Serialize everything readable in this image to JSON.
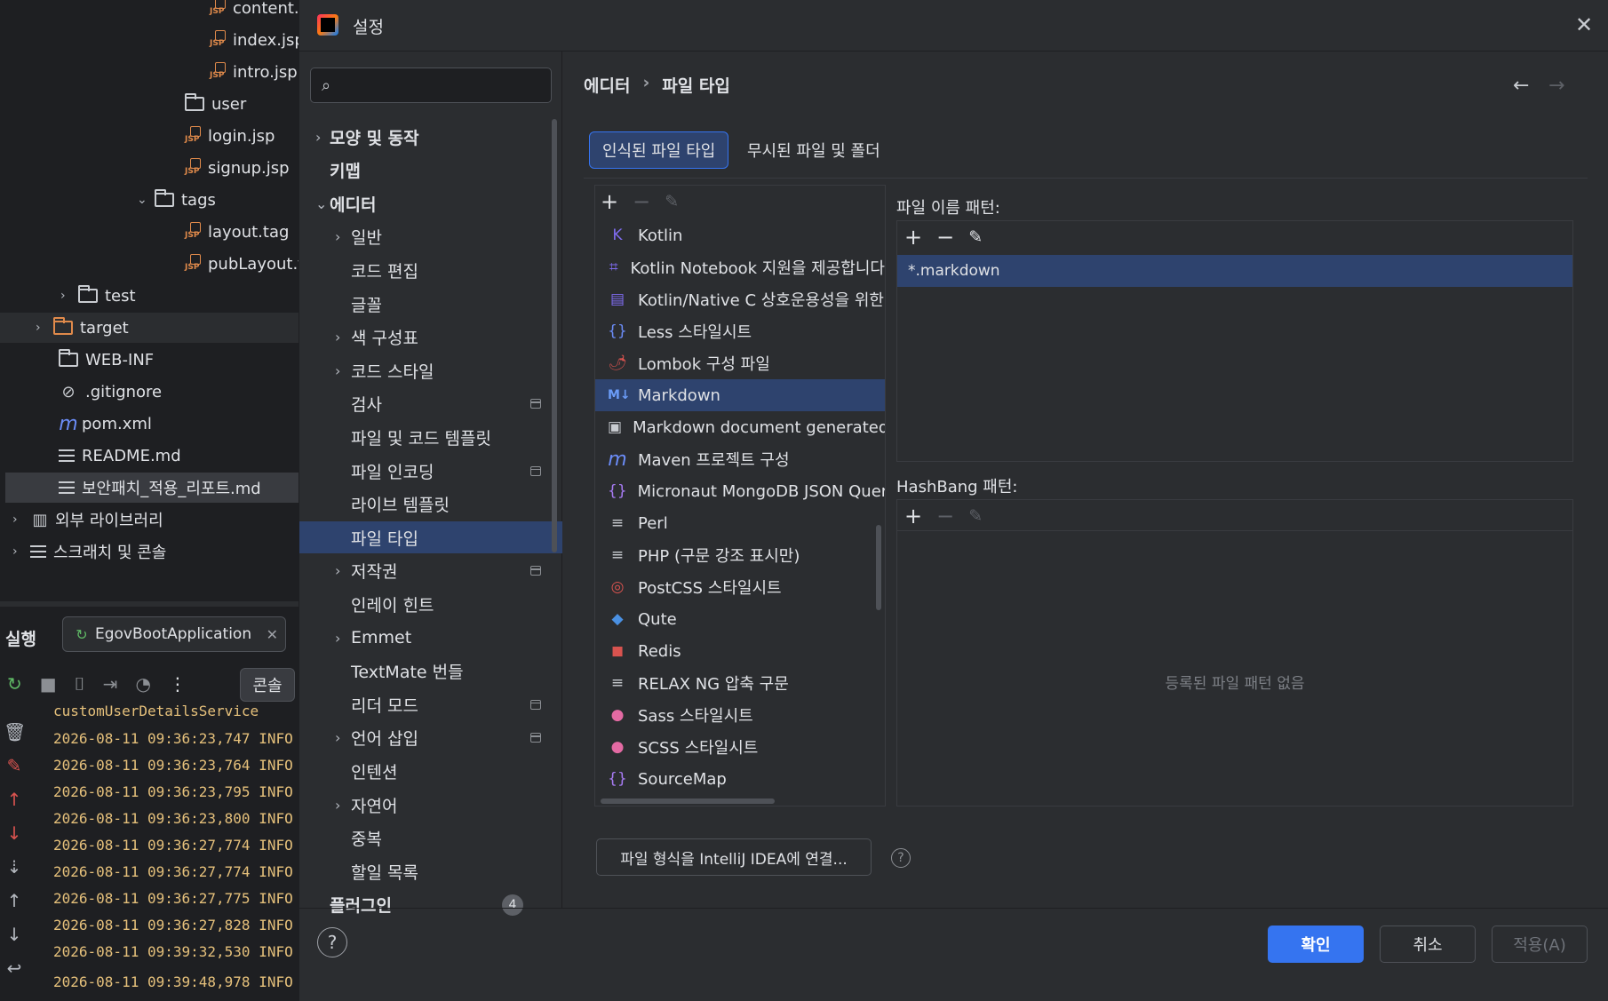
{
  "project_tree": {
    "items": [
      {
        "label": "content.j",
        "type": "jsp"
      },
      {
        "label": "index.jsp",
        "type": "jsp"
      },
      {
        "label": "intro.jsp",
        "type": "jsp"
      },
      {
        "label": "user",
        "type": "folder"
      },
      {
        "label": "login.jsp",
        "type": "jsp"
      },
      {
        "label": "signup.jsp",
        "type": "jsp"
      },
      {
        "label": "tags",
        "type": "folder"
      },
      {
        "label": "layout.tag",
        "type": "jsp"
      },
      {
        "label": "pubLayout.ta",
        "type": "jsp"
      },
      {
        "label": "test",
        "type": "folder"
      },
      {
        "label": "target",
        "type": "folder"
      },
      {
        "label": "WEB-INF",
        "type": "folder"
      },
      {
        "label": ".gitignore",
        "type": "ignore"
      },
      {
        "label": "pom.xml",
        "type": "maven"
      },
      {
        "label": "README.md",
        "type": "md"
      },
      {
        "label": "보안패치_적용_리포트.md",
        "type": "md"
      },
      {
        "label": "외부 라이브러리",
        "type": "lib"
      },
      {
        "label": "스크래치 및 콘솔",
        "type": "scratch"
      }
    ]
  },
  "run_panel": {
    "title": "실행",
    "tab_label": "EgovBootApplication",
    "console_label": "콘솔",
    "log_header": "customUserDetailsService",
    "logs": [
      "2026-08-11 09:36:23,747  INFO |",
      "2026-08-11 09:36:23,764  INFO |",
      "2026-08-11 09:36:23,795  INFO |",
      "2026-08-11 09:36:23,800  INFO |",
      "2026-08-11 09:36:27,774  INFO |",
      "2026-08-11 09:36:27,774  INFO |",
      "2026-08-11 09:36:27,775  INFO |",
      "2026-08-11 09:36:27,828  INFO |",
      "2026-08-11 09:39:32,530  INFO |",
      "2026-08-11 09:39:48,978  INFO [kr.go.kma.radar.ptl.pub.web.PubController] ===> [PubController] 내국인 공개 홈(안글) 진입."
    ]
  },
  "dialog": {
    "title": "설정",
    "search_placeholder": "",
    "nav": {
      "items": [
        {
          "label": "모양 및 동작",
          "bold": true,
          "chevron": "right"
        },
        {
          "label": "키맵",
          "bold": true
        },
        {
          "label": "에디터",
          "bold": true,
          "chevron": "down"
        },
        {
          "label": "일반",
          "chevron": "right"
        },
        {
          "label": "코드 편집"
        },
        {
          "label": "글꼴"
        },
        {
          "label": "색 구성표",
          "chevron": "right"
        },
        {
          "label": "코드 스타일",
          "chevron": "right"
        },
        {
          "label": "검사",
          "icon": true
        },
        {
          "label": "파일 및 코드 템플릿"
        },
        {
          "label": "파일 인코딩",
          "icon": true
        },
        {
          "label": "라이브 템플릿"
        },
        {
          "label": "파일 타입",
          "selected": true
        },
        {
          "label": "저작권",
          "chevron": "right",
          "icon": true
        },
        {
          "label": "인레이 힌트"
        },
        {
          "label": "Emmet",
          "chevron": "right"
        },
        {
          "label": "TextMate 번들"
        },
        {
          "label": "리더 모드",
          "icon": true
        },
        {
          "label": "언어 삽입",
          "chevron": "right",
          "icon": true
        },
        {
          "label": "인텐션"
        },
        {
          "label": "자연어",
          "chevron": "right"
        },
        {
          "label": "중복"
        },
        {
          "label": "할일 목록"
        },
        {
          "label": "플러그인",
          "bold": true,
          "badge": "4"
        }
      ]
    },
    "breadcrumb": {
      "parent": "에디터",
      "sep": "›",
      "current": "파일 타입"
    },
    "tabs": [
      {
        "label": "인식된 파일 타입",
        "selected": true
      },
      {
        "label": "무시된 파일 및 폴더"
      }
    ],
    "file_types": [
      {
        "label": "Kotlin",
        "icon": "K",
        "color": "#7f6cf0"
      },
      {
        "label": "Kotlin Notebook 지원을 제공합니다",
        "icon": "⌗",
        "color": "#7f6cf0"
      },
      {
        "label": "Kotlin/Native C 상호운용성을 위한",
        "icon": "▤",
        "color": "#7f6cf0"
      },
      {
        "label": "Less 스타일시트",
        "icon": "{}",
        "color": "#6b8cf7"
      },
      {
        "label": "Lombok 구성 파일",
        "icon": "🌶",
        "color": "#d9534f"
      },
      {
        "label": "Markdown",
        "icon": "M↓",
        "color": "#6b9cf7",
        "selected": true
      },
      {
        "label": "Markdown document generated b",
        "icon": "▣",
        "color": "#c9ccd1"
      },
      {
        "label": "Maven 프로젝트 구성",
        "icon": "m",
        "color": "#6b8cf7"
      },
      {
        "label": "Micronaut MongoDB JSON Query",
        "icon": "{}",
        "color": "#a77bf3"
      },
      {
        "label": "Perl",
        "icon": "≡",
        "color": "#c9ccd1"
      },
      {
        "label": "PHP (구문 강조 표시만)",
        "icon": "≡",
        "color": "#c9ccd1"
      },
      {
        "label": "PostCSS 스타일시트",
        "icon": "◎",
        "color": "#d9534f"
      },
      {
        "label": "Qute",
        "icon": "◆",
        "color": "#4a90e2"
      },
      {
        "label": "Redis",
        "icon": "◼",
        "color": "#d9534f"
      },
      {
        "label": "RELAX NG 압축 구문",
        "icon": "≡",
        "color": "#c9ccd1"
      },
      {
        "label": "Sass 스타일시트",
        "icon": "●",
        "color": "#e36aa3"
      },
      {
        "label": "SCSS 스타일시트",
        "icon": "●",
        "color": "#e36aa3"
      },
      {
        "label": "SourceMap",
        "icon": "{}",
        "color": "#a77bf3"
      }
    ],
    "file_name_patterns": {
      "label": "파일 이름 패턴:",
      "items": [
        "*.markdown"
      ]
    },
    "hashbang_patterns": {
      "label": "HashBang 패턴:",
      "empty_text": "등록된 파일 패턴 없음"
    },
    "associate_button": "파일 형식을 IntelliJ IDEA에 연결...",
    "buttons": {
      "ok": "확인",
      "cancel": "취소",
      "apply": "적용(A)"
    },
    "accent": "#3574f0",
    "selection": "#2e436e"
  }
}
